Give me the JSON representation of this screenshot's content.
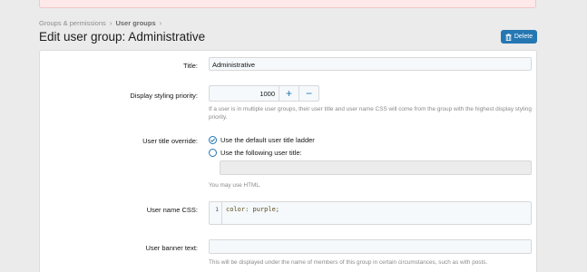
{
  "breadcrumb": {
    "items": [
      "Groups & permissions",
      "User groups"
    ],
    "separator": "›"
  },
  "page": {
    "title": "Edit user group: Administrative",
    "delete_label": "Delete"
  },
  "form": {
    "title": {
      "label": "Title:",
      "value": "Administrative"
    },
    "display_priority": {
      "label": "Display styling priority:",
      "value": "1000",
      "increment": "+",
      "decrement": "−",
      "explain": "If a user is in multiple user groups, their user title and user name CSS will come from the group with the highest display styling priority."
    },
    "user_title_override": {
      "label": "User title override:",
      "option_default": "Use the default user title ladder",
      "option_custom": "Use the following user title:",
      "selected": "default",
      "custom_value": "",
      "explain": "You may use HTML."
    },
    "username_css": {
      "label": "User name CSS:",
      "line_number": "1",
      "code": "color: purple;"
    },
    "banner_text": {
      "label": "User banner text:",
      "value": "",
      "explain": "This will be displayed under the name of members of this group in certain circumstances, such as with posts."
    }
  },
  "colors": {
    "accent": "#2577b1",
    "delete_button": "#2577b1",
    "alert_bg": "#fde9e9"
  }
}
